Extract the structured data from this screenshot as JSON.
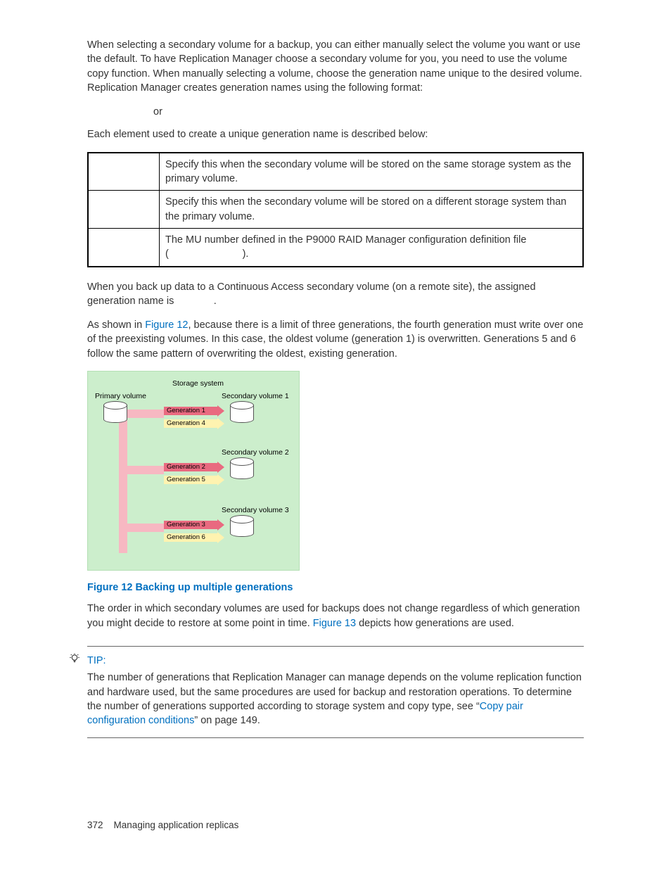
{
  "para1": "When selecting a secondary volume for a backup, you can either manually select the volume you want or use the default. To have Replication Manager choose a secondary volume for you, you need to use the volume copy function. When manually selecting a volume, choose the generation name unique to the desired volume. Replication Manager creates generation names using the following format:",
  "or_text": "or",
  "para2": "Each element used to create a unique generation name is described below:",
  "table": {
    "row1": {
      "desc": "Specify this when the secondary volume will be stored on the same storage system as the primary volume."
    },
    "row2": {
      "desc": "Specify this when the secondary volume will be stored on a different storage system than the primary volume."
    },
    "row3": {
      "desc_pre": "The MU number defined in the P9000 RAID Manager configuration definition file (",
      "desc_post": ")."
    }
  },
  "para3": {
    "pre": "When you back up data to a Continuous Access secondary volume (on a remote site), the assigned generation name is ",
    "post": "."
  },
  "para4": {
    "pre": "As shown in ",
    "link": "Figure 12",
    "post": ", because there is a limit of three generations, the fourth generation must write over one of the preexisting volumes. In this case, the oldest volume (generation 1) is overwritten. Generations 5 and 6 follow the same pattern of overwriting the oldest, existing generation."
  },
  "diagram": {
    "storage_system": "Storage system",
    "primary_volume": "Primary volume",
    "sv1": "Secondary volume 1",
    "sv2": "Secondary volume 2",
    "sv3": "Secondary volume 3",
    "g1": "Generation 1",
    "g2": "Generation 2",
    "g3": "Generation 3",
    "g4": "Generation 4",
    "g5": "Generation 5",
    "g6": "Generation 6"
  },
  "figure_caption": "Figure 12 Backing up multiple generations",
  "para5": {
    "pre": "The order in which secondary volumes are used for backups does not change regardless of which generation you might decide to restore at some point in time. ",
    "link": "Figure 13",
    "post": " depicts how generations are used."
  },
  "tip": {
    "label": "TIP:",
    "body_pre": "The number of generations that Replication Manager can manage depends on the volume replication function and hardware used, but the same procedures are used for backup and restoration operations. To determine the number of generations supported according to storage system and copy type, see “",
    "link": "Copy pair configuration conditions",
    "body_post": "” on page 149."
  },
  "footer": {
    "page": "372",
    "title": "Managing application replicas"
  }
}
